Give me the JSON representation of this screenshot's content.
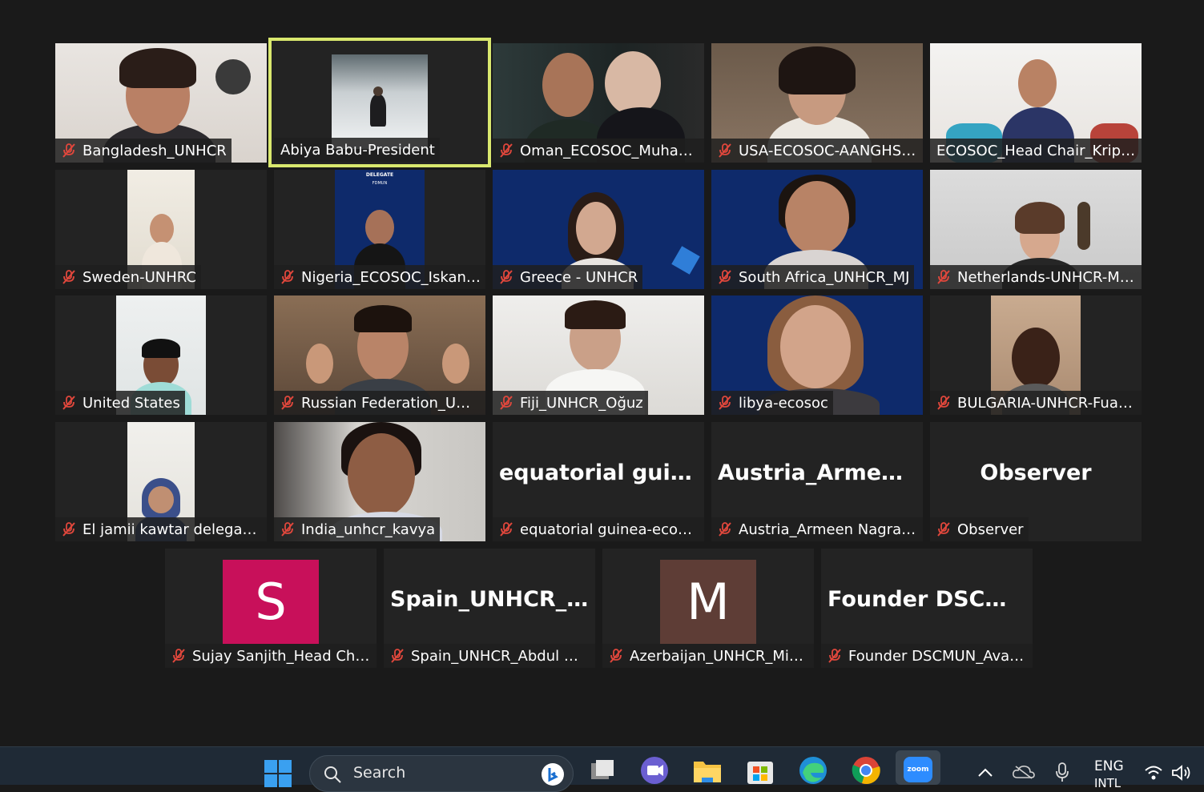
{
  "participants": [
    {
      "name": "Bangladesh_UNHCR"
    },
    {
      "name": "Abiya Babu-President"
    },
    {
      "name": "Oman_ECOSOC_Muham..."
    },
    {
      "name": "USA-ECOSOC-AANGHSH..."
    },
    {
      "name": "ECOSOC_Head Chair_Kripa ..."
    },
    {
      "name": "Sweden-UNHRC"
    },
    {
      "name": "Nigeria_ECOSOC_Iskande..."
    },
    {
      "name": "Greece - UNHCR"
    },
    {
      "name": "South Africa_UNHCR_MJ"
    },
    {
      "name": "Netherlands-UNHCR-Ma..."
    },
    {
      "name": "United States"
    },
    {
      "name": "Russian Federation_UNS..."
    },
    {
      "name": "Fiji_UNHCR_Oğuz"
    },
    {
      "name": "libya-ecosoc"
    },
    {
      "name": "BULGARIA-UNHCR-Fuad ..."
    },
    {
      "name": "El jamii kawtar delegate ..."
    },
    {
      "name": "India_unhcr_kavya"
    },
    {
      "name": "equatorial guinea-ecosoc...",
      "display": "equatorial  guin..."
    },
    {
      "name": "Austria_Armeen Nagra_H...",
      "display": "Austria_Armeen..."
    },
    {
      "name": "Observer",
      "display": "Observer"
    },
    {
      "name": "Sujay Sanjith_Head Chair...",
      "avatar_letter": "S",
      "avatar_color": "#c8105a"
    },
    {
      "name": "Spain_UNHCR_Abdul mat...",
      "display": "Spain_UNHCR_..."
    },
    {
      "name": "Azerbaijan_UNHCR_Mirz...",
      "avatar_letter": "M",
      "avatar_color": "#5e3d36"
    },
    {
      "name": "Founder DSCMUN_Avani ...",
      "display": "Founder  DSCM..."
    }
  ],
  "delegate_poster": {
    "line1": "DELEGATE",
    "line2": "FDMUN"
  },
  "taskbar": {
    "search_placeholder": "Search",
    "zoom_label": "zoom",
    "lang": "ENG",
    "lang_sub": "INTL"
  },
  "colors": {
    "speaking_border": "#d9e86e",
    "mic_off": "#e0473c",
    "tile_bg": "#232323"
  }
}
